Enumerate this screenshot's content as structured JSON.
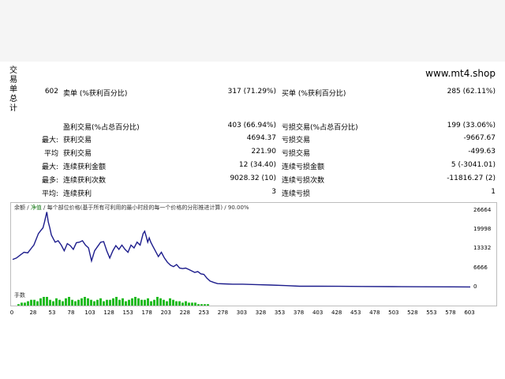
{
  "header": {
    "site": "www.mt4.shop",
    "side_label": "交易单总计"
  },
  "stats": {
    "total_trades": "602",
    "short_label": "卖单 (%获利百分比)",
    "short_value": "317 (71.29%)",
    "long_label": "买单 (%获利百分比)",
    "long_value": "285 (62.11%)",
    "win_label": "盈利交易(%占总百分比)",
    "win_value": "403 (66.94%)",
    "loss_label": "亏损交易(%占总百分比)",
    "loss_value": "199 (33.06%)",
    "row_max_prefix": "最大:",
    "max_win_label": "获利交易",
    "max_win_value": "4694.37",
    "max_loss_label": "亏损交易",
    "max_loss_value": "-9667.67",
    "row_avg_prefix": "平均",
    "avg_win_label": "获利交易",
    "avg_win_value": "221.90",
    "avg_loss_label": "亏损交易",
    "avg_loss_value": "-499.63",
    "row_maxcons_prefix": "最大:",
    "cons_win_amt_label": "连续获利金额",
    "cons_win_amt_value": "12 (34.40)",
    "cons_loss_amt_label": "连续亏损金额",
    "cons_loss_amt_value": "5 (-3041.01)",
    "row_most_prefix": "最多:",
    "cons_win_cnt_label": "连续获利次数",
    "cons_win_cnt_value": "9028.32 (10)",
    "cons_loss_cnt_label": "连续亏损次数",
    "cons_loss_cnt_value": "-11816.27 (2)",
    "row_avgcons_prefix": "平均:",
    "avg_cons_win_label": "连续获利",
    "avg_cons_win_value": "3",
    "avg_cons_loss_label": "连续亏损",
    "avg_cons_loss_value": "1"
  },
  "chart_caption": {
    "balance": "余额",
    "sep1": " / ",
    "equity": "净值",
    "sep2": " / ",
    "rest": "每个部位价格(基于所有可利用的最小时段的每一个价格的分形推进计算) / 90.00%"
  },
  "volume_caption": "手数",
  "colors": {
    "balance_line": "#1c1c8c",
    "volume_bars": "#22bb22",
    "frame": "#bdbdbd"
  },
  "chart_data": {
    "type": "line",
    "title": "",
    "xlabel": "",
    "ylabel": "",
    "ylim": [
      0,
      28000
    ],
    "y_ticks": [
      "26664",
      "19998",
      "13332",
      "6666",
      "0"
    ],
    "y_tick_values": [
      26664,
      19998,
      13332,
      6666,
      0
    ],
    "x_ticks": [
      "0",
      "28",
      "53",
      "78",
      "103",
      "128",
      "153",
      "178",
      "203",
      "228",
      "253",
      "278",
      "303",
      "328",
      "353",
      "378",
      "403",
      "428",
      "453",
      "478",
      "503",
      "528",
      "553",
      "578",
      "603"
    ],
    "xlim": [
      0,
      603
    ],
    "series": [
      {
        "x": [
          0,
          5,
          10,
          15,
          20,
          25,
          28,
          31,
          34,
          37,
          40,
          42,
          45,
          47,
          49,
          51,
          53,
          56,
          60,
          64,
          68,
          72,
          76,
          80,
          84,
          88,
          92,
          96,
          100,
          104,
          108,
          112,
          116,
          120,
          124,
          128,
          132,
          136,
          140,
          144,
          148,
          152,
          156,
          160,
          164,
          168,
          172,
          174,
          176,
          178,
          180,
          182,
          185,
          188,
          192,
          196,
          200,
          204,
          208,
          212,
          216,
          220,
          224,
          228,
          232,
          236,
          240,
          244,
          248,
          252,
          256,
          260,
          265,
          270,
          278,
          290,
          303,
          320,
          340,
          360,
          378,
          400,
          430,
          460,
          500,
          540,
          580,
          603
        ],
        "y": [
          10000,
          10500,
          11500,
          12500,
          12300,
          14000,
          15000,
          17000,
          19000,
          20000,
          21000,
          23000,
          26500,
          23000,
          21000,
          18500,
          17500,
          16000,
          16500,
          15000,
          13000,
          15500,
          14800,
          13500,
          15800,
          16000,
          16500,
          15000,
          14000,
          9500,
          13000,
          14500,
          16000,
          16200,
          13000,
          10500,
          13000,
          14800,
          13500,
          15000,
          13500,
          12500,
          15000,
          14000,
          16000,
          15000,
          19000,
          19800,
          18000,
          16000,
          17500,
          16000,
          14500,
          13000,
          11000,
          12500,
          10500,
          9000,
          8000,
          7500,
          8200,
          7000,
          6800,
          7000,
          6500,
          6000,
          5500,
          5800,
          5000,
          4800,
          3500,
          2500,
          2000,
          1600,
          1500,
          1400,
          1400,
          1250,
          1100,
          900,
          700,
          700,
          650,
          600,
          550,
          500,
          480,
          450
        ]
      }
    ],
    "volume_bars": [
      1,
      2,
      2,
      3,
      4,
      4,
      3,
      5,
      6,
      6,
      4,
      3,
      5,
      4,
      3,
      5,
      6,
      4,
      3,
      4,
      5,
      6,
      5,
      4,
      3,
      4,
      5,
      3,
      4,
      4,
      5,
      6,
      4,
      5,
      3,
      4,
      5,
      6,
      5,
      4,
      4,
      5,
      3,
      4,
      6,
      5,
      4,
      3,
      5,
      4,
      3,
      3,
      2,
      3,
      2,
      2,
      2,
      1,
      1,
      1,
      1
    ]
  }
}
